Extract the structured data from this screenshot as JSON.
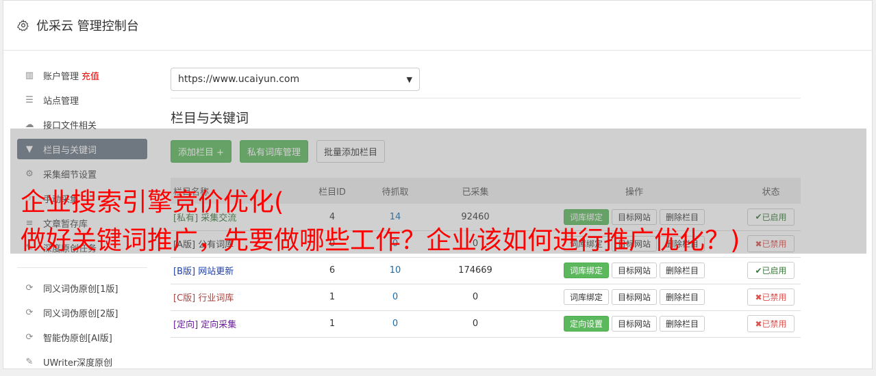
{
  "header": {
    "title": "优采云 管理控制台"
  },
  "sidebar": {
    "items": [
      {
        "label": "账户管理",
        "extra": "充值",
        "icon": "bar-chart-icon",
        "glyph": "▥"
      },
      {
        "label": "站点管理",
        "icon": "server-icon",
        "glyph": "☰"
      },
      {
        "label": "接口文件相关",
        "icon": "cloud-upload-icon",
        "glyph": "☁"
      },
      {
        "label": "栏目与关键词",
        "icon": "filter-icon",
        "glyph": "▼",
        "active": true
      },
      {
        "label": "采集细节设置",
        "icon": "gears-icon",
        "glyph": "⚙"
      },
      {
        "label": "手动采集",
        "icon": "hand-icon",
        "glyph": "☞"
      },
      {
        "label": "文章暂存库",
        "icon": "database-icon",
        "glyph": "≡"
      },
      {
        "label": "深度原创任务",
        "icon": "task-icon",
        "glyph": "✎"
      }
    ],
    "items2": [
      {
        "label": "同义词伪原创[1版]",
        "icon": "refresh-icon",
        "glyph": "⟳"
      },
      {
        "label": "同义词伪原创[2版]",
        "icon": "refresh-icon",
        "glyph": "⟳"
      },
      {
        "label": "智能伪原创[AI版]",
        "icon": "refresh-icon",
        "glyph": "⟳"
      },
      {
        "label": "UWriter深度原创",
        "icon": "edit-icon",
        "glyph": "✎"
      }
    ]
  },
  "main": {
    "site_select": "https://www.ucaiyun.com",
    "section_title": "栏目与关键词",
    "buttons": {
      "add": "添加栏目 +",
      "private_lib": "私有词库管理",
      "batch_add": "批量添加栏目"
    },
    "table": {
      "headers": [
        "栏目名称",
        "栏目ID",
        "待抓取",
        "已采集",
        "操作",
        "状态"
      ],
      "rows": [
        {
          "tag": "[私有]",
          "name": "采集交流",
          "id": "4",
          "pending": "14",
          "collected": "92460",
          "op1": "词库绑定",
          "op2": "目标网站",
          "op3": "删除栏目",
          "status": "已启用"
        },
        {
          "tag": "[A版]",
          "name": "公有词库",
          "id": "0",
          "pending": "0",
          "collected": "0",
          "op1": "词库绑定",
          "op2": "目标网站",
          "op3": "删除栏目",
          "status": "已禁用"
        },
        {
          "tag": "[B版]",
          "name": "网站更新",
          "id": "6",
          "pending": "10",
          "collected": "174669",
          "op1": "词库绑定",
          "op2": "目标网站",
          "op3": "删除栏目",
          "status": "已启用"
        },
        {
          "tag": "[C版]",
          "name": "行业词库",
          "id": "1",
          "pending": "0",
          "collected": "0",
          "op1": "词库绑定",
          "op2": "目标网站",
          "op3": "删除栏目",
          "status": "已禁用"
        },
        {
          "tag": "[定向]",
          "name": "定向采集",
          "id": "1",
          "pending": "0",
          "collected": "0",
          "op1": "定向设置",
          "op2": "目标网站",
          "op3": "删除栏目",
          "status": "已禁用"
        }
      ]
    }
  },
  "overlay_text": {
    "line1": "企业搜索引擎竞价优化(",
    "line2": "做好关键词推广，先要做哪些工作？企业该如何进行推广优化？)"
  },
  "colors": {
    "active_sidebar": "#6b7785",
    "green": "#5cb85c",
    "overlay_text": "#ff0000"
  }
}
